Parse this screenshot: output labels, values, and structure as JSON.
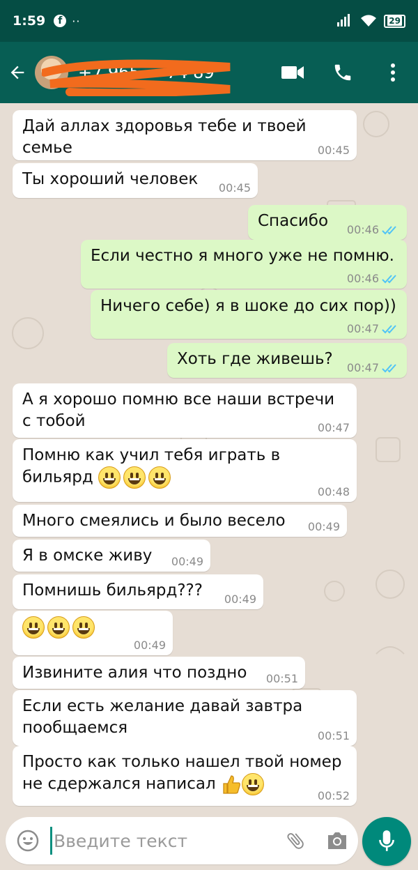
{
  "status_bar": {
    "time": "1:59",
    "fb_icon": "facebook-icon",
    "dots": "··",
    "battery": "29"
  },
  "header": {
    "contact_name": "+7 965 ··· 74 89",
    "actions": [
      "video-call-icon",
      "phone-icon",
      "more-vert-icon"
    ]
  },
  "messages": [
    {
      "dir": "in",
      "text": "Дай аллах здоровья тебе и твоей\nсемье",
      "time": "00:45"
    },
    {
      "dir": "in",
      "text": "Ты хороший человек",
      "time": "00:45"
    },
    {
      "dir": "out",
      "text": "Спасибо",
      "time": "00:46",
      "status": "read"
    },
    {
      "dir": "out",
      "text": "Если честно я много уже не помню.",
      "time": "00:46",
      "status": "read"
    },
    {
      "dir": "out",
      "text": "Ничего себе) я в шоке до сих пор))",
      "time": "00:47",
      "status": "read"
    },
    {
      "dir": "out",
      "text": "Хоть где живешь?",
      "time": "00:47",
      "status": "read"
    },
    {
      "dir": "in",
      "text": "А я хорошо помню все наши встречи\nс тобой",
      "time": "00:47"
    },
    {
      "dir": "in",
      "text": "Помню как учил тебя играть в\nбильярд",
      "emoji": 3,
      "time": "00:48"
    },
    {
      "dir": "in",
      "text": "Много смеялись и было весело",
      "time": "00:49"
    },
    {
      "dir": "in",
      "text": "Я в омске живу",
      "time": "00:49"
    },
    {
      "dir": "in",
      "text": "Помнишь бильярд???",
      "time": "00:49"
    },
    {
      "dir": "in",
      "text": "",
      "emoji": 3,
      "time": "00:49"
    },
    {
      "dir": "in",
      "text": "Извините алия что поздно",
      "time": "00:51"
    },
    {
      "dir": "in",
      "text": "Если есть желание давай завтра\nпообщаемся",
      "time": "00:51"
    },
    {
      "dir": "in",
      "text": "Просто как только нашел твой номер\nне сдержался написал",
      "thumb": true,
      "emoji": 1,
      "time": "00:52"
    }
  ],
  "input": {
    "placeholder": "Введите текст",
    "value": ""
  },
  "colors": {
    "header": "#075e54",
    "status_bar": "#054d44",
    "outgoing_bubble": "#dcf8c6",
    "incoming_bubble": "#ffffff",
    "read_tick": "#4fc3f7",
    "mic_button": "#00897b"
  }
}
